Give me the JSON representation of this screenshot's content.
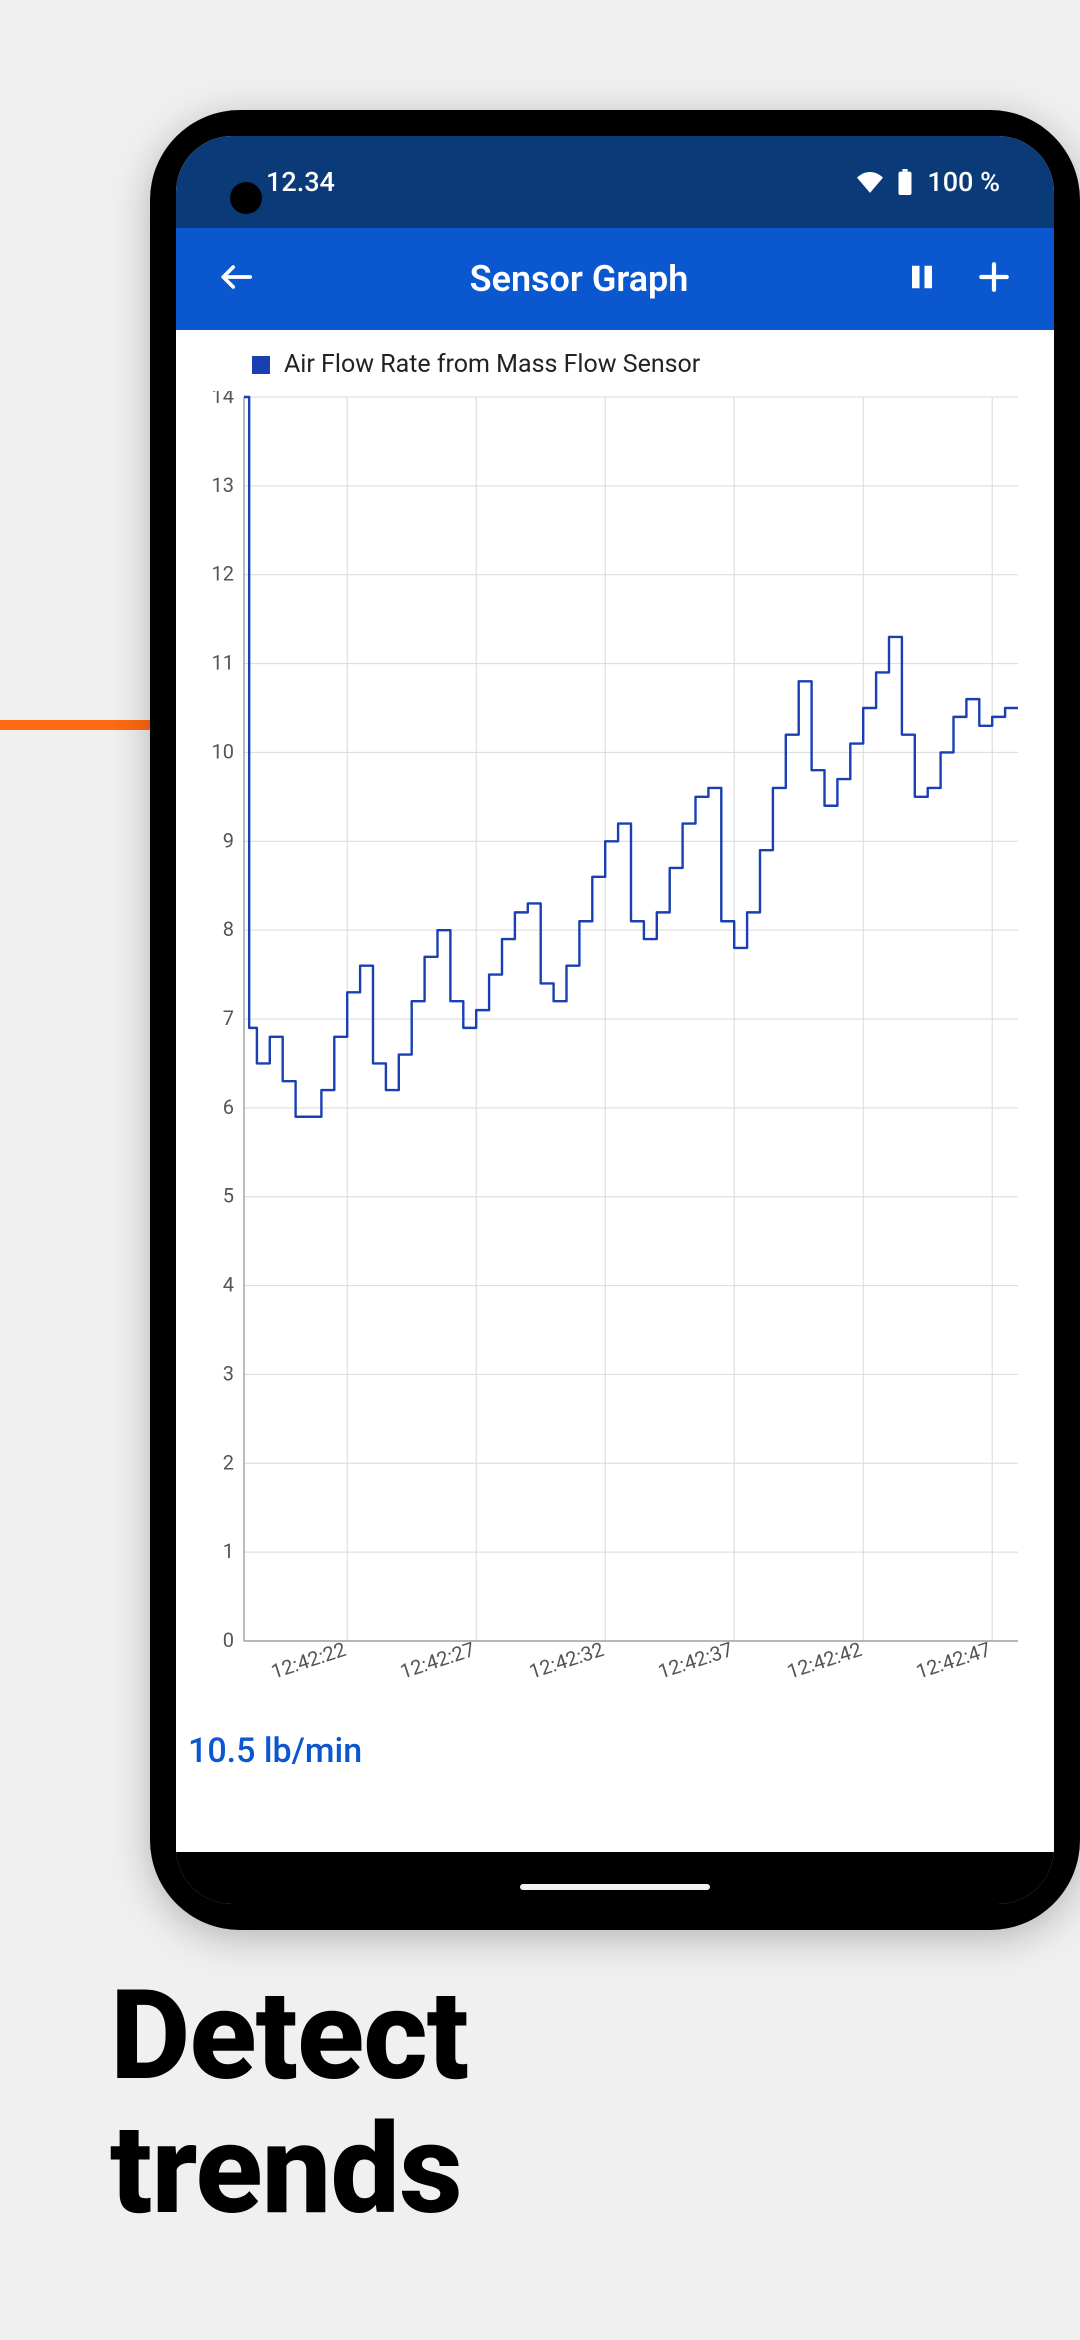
{
  "marketing": {
    "headline_line1": "Detect",
    "headline_line2": "trends"
  },
  "status_bar": {
    "time": "12.34",
    "battery_text": "100 %",
    "wifi_icon": "wifi-icon",
    "battery_icon": "battery-full-icon"
  },
  "app_bar": {
    "title": "Sensor Graph",
    "back_icon": "arrow-left-icon",
    "pause_icon": "pause-icon",
    "add_icon": "plus-icon"
  },
  "legend": {
    "series_name": "Air Flow Rate from Mass Flow Sensor",
    "series_color": "#1a3fb3"
  },
  "current_reading": "10.5 lb/min",
  "chart_data": {
    "type": "line",
    "title": "",
    "xlabel": "",
    "ylabel": "",
    "ylim": [
      0,
      14
    ],
    "y_ticks": [
      0,
      1,
      2,
      3,
      4,
      5,
      6,
      7,
      8,
      9,
      10,
      11,
      12,
      13,
      14
    ],
    "x_tick_labels": [
      "12:42:22",
      "12:42:27",
      "12:42:32",
      "12:42:37",
      "12:42:42",
      "12:42:47"
    ],
    "x_tick_positions": [
      22,
      27,
      32,
      37,
      42,
      47
    ],
    "x_range": [
      18,
      48
    ],
    "series": [
      {
        "name": "Air Flow Rate from Mass Flow Sensor",
        "color": "#1a3fb3",
        "x": [
          18,
          18.2,
          18.5,
          19,
          19.5,
          20,
          20.5,
          21,
          21.5,
          22,
          22.5,
          23,
          23.5,
          24,
          24.5,
          25,
          25.5,
          26,
          26.5,
          27,
          27.5,
          28,
          28.5,
          29,
          29.5,
          30,
          30.5,
          31,
          31.5,
          32,
          32.5,
          33,
          33.5,
          34,
          34.5,
          35,
          35.5,
          36,
          36.5,
          37,
          37.5,
          38,
          38.5,
          39,
          39.5,
          40,
          40.5,
          41,
          41.5,
          42,
          42.5,
          43,
          43.5,
          44,
          44.5,
          45,
          45.5,
          46,
          46.5,
          47,
          47.5,
          48
        ],
        "values": [
          14.0,
          6.9,
          6.5,
          6.8,
          6.3,
          5.9,
          5.9,
          6.2,
          6.8,
          7.3,
          7.6,
          6.5,
          6.2,
          6.6,
          7.2,
          7.7,
          8.0,
          7.2,
          6.9,
          7.1,
          7.5,
          7.9,
          8.2,
          8.3,
          7.4,
          7.2,
          7.6,
          8.1,
          8.6,
          9.0,
          9.2,
          8.1,
          7.9,
          8.2,
          8.7,
          9.2,
          9.5,
          9.6,
          8.1,
          7.8,
          8.2,
          8.9,
          9.6,
          10.2,
          10.8,
          9.8,
          9.4,
          9.7,
          10.1,
          10.5,
          10.9,
          11.3,
          10.2,
          9.5,
          9.6,
          10.0,
          10.4,
          10.6,
          10.3,
          10.4,
          10.5,
          10.5
        ]
      }
    ]
  }
}
